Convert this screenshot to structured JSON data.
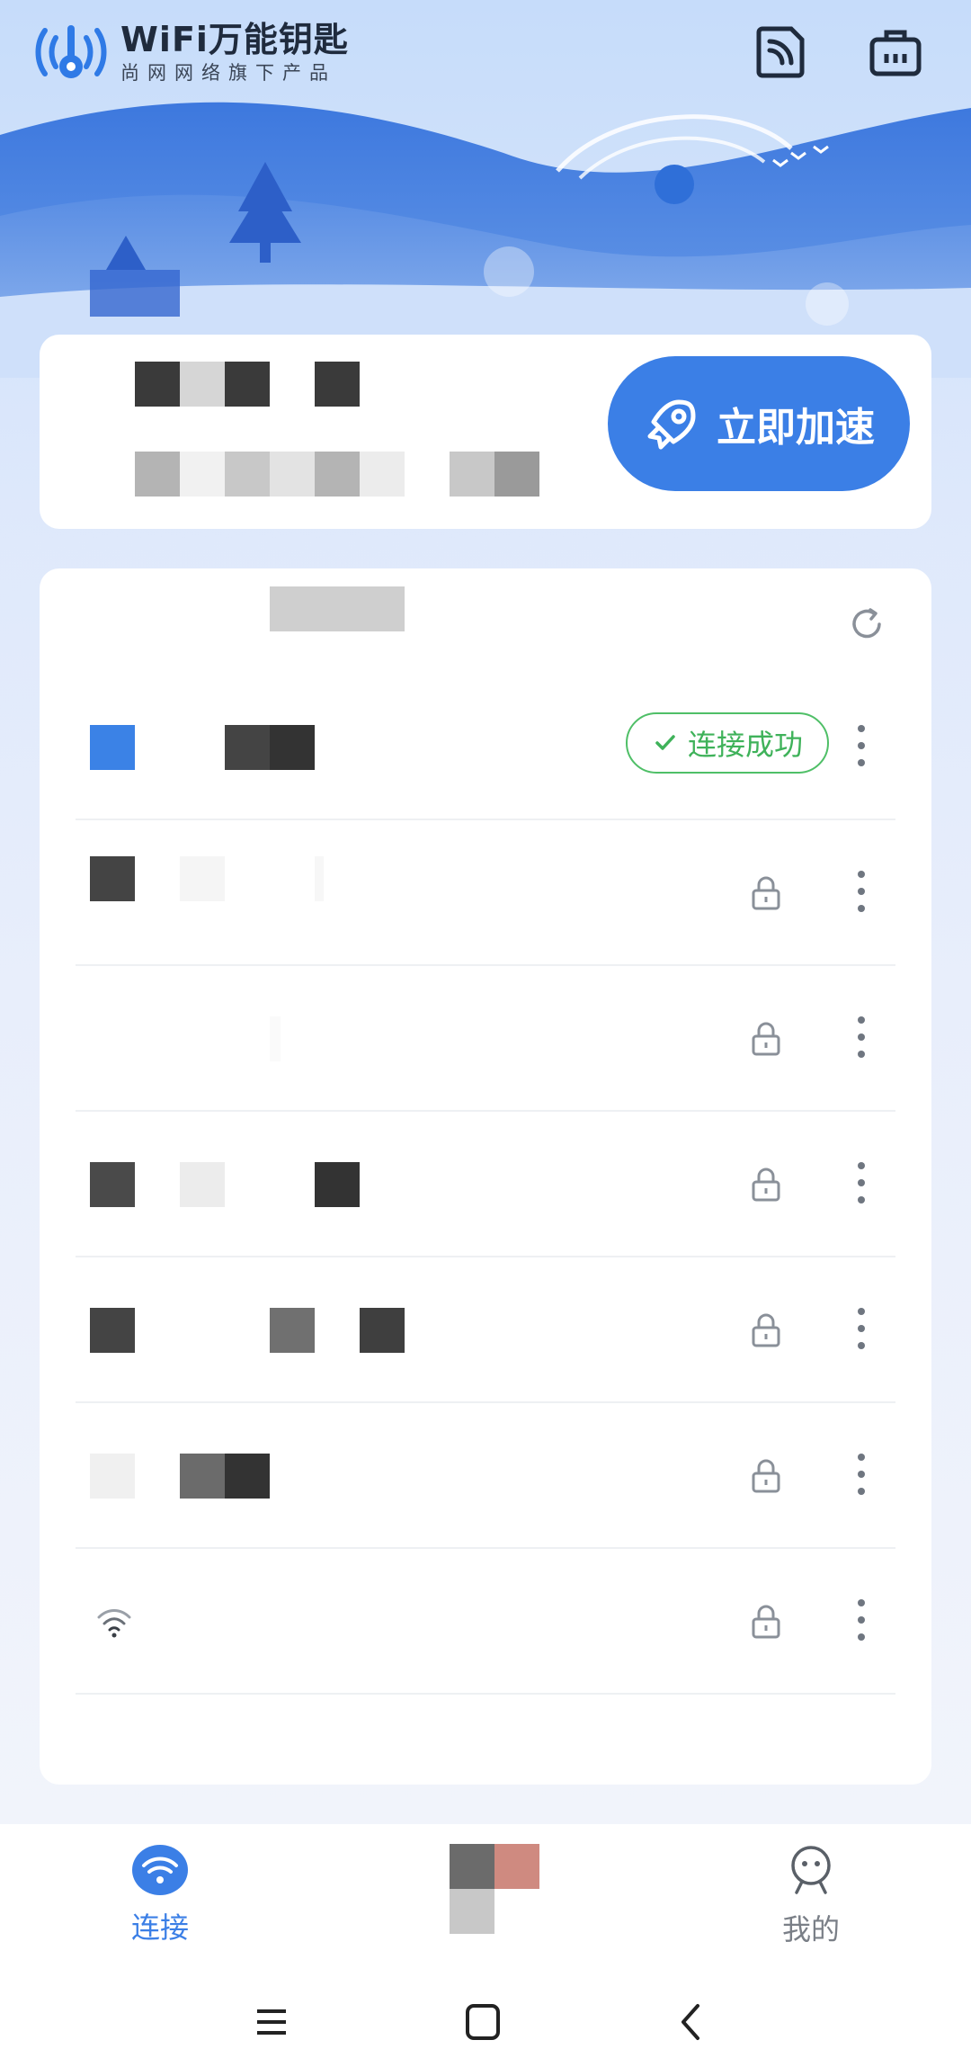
{
  "app": {
    "title": "WiFi万能钥匙",
    "subtitle": "尚网网络旗下产品"
  },
  "header": {
    "icons": [
      "report-icon",
      "toolbox-icon"
    ]
  },
  "boost": {
    "label": "立即加速",
    "icon": "rocket-icon"
  },
  "list": {
    "refresh_icon": "refresh-icon",
    "rows": [
      {
        "status": "连接成功",
        "status_icon": "check-icon",
        "action_icon": "more-vertical-icon"
      },
      {
        "lock_icon": "lock-icon",
        "action_icon": "more-vertical-icon"
      },
      {
        "lock_icon": "lock-icon",
        "action_icon": "more-vertical-icon"
      },
      {
        "lock_icon": "lock-icon",
        "action_icon": "more-vertical-icon"
      },
      {
        "lock_icon": "lock-icon",
        "action_icon": "more-vertical-icon"
      },
      {
        "lock_icon": "lock-icon",
        "action_icon": "more-vertical-icon"
      },
      {
        "lock_icon": "lock-icon",
        "action_icon": "more-vertical-icon"
      }
    ]
  },
  "bottom_nav": {
    "tabs": [
      {
        "label": "连接",
        "icon": "wifi-icon",
        "active": true
      },
      {
        "label": "我的",
        "icon": "profile-icon",
        "active": false
      }
    ]
  },
  "colors": {
    "accent": "#3b7fe6",
    "success": "#3fb25a",
    "inactive": "#7a7f87"
  }
}
